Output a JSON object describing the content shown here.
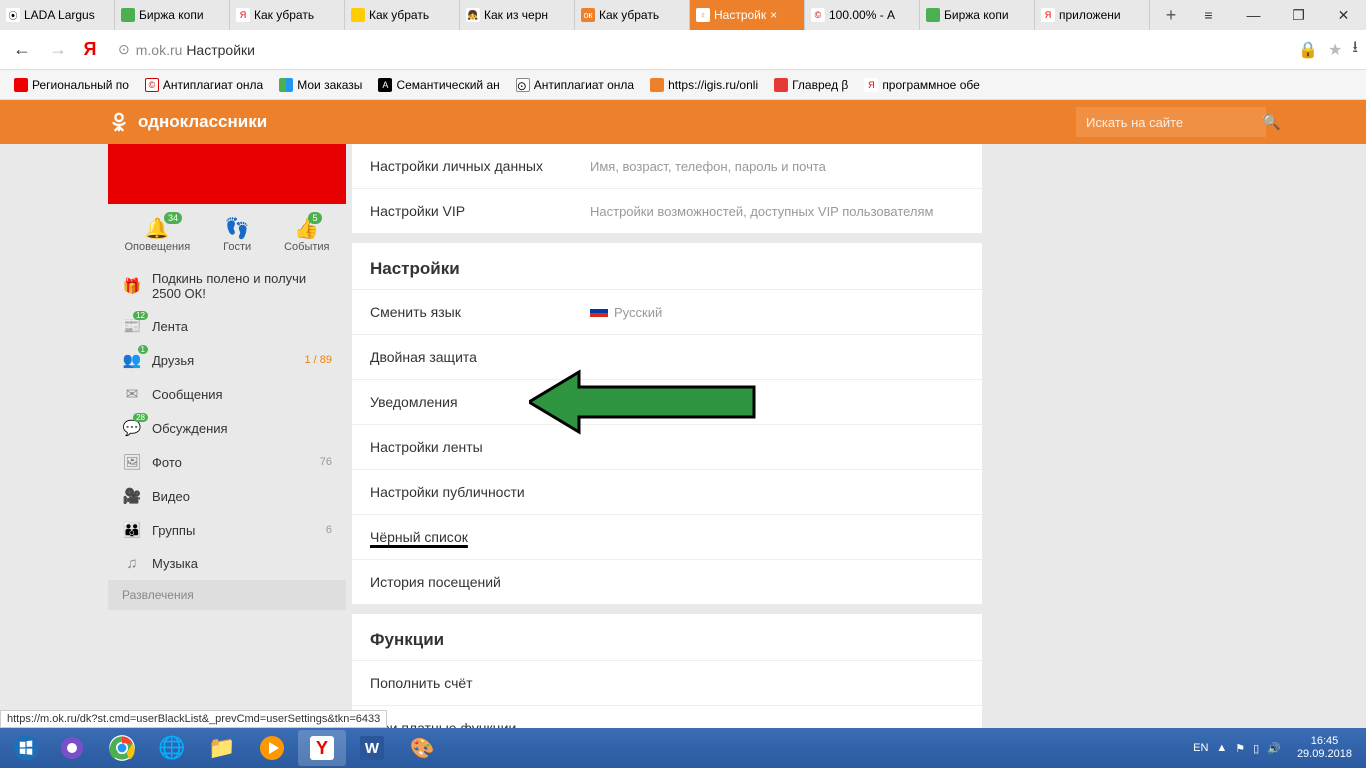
{
  "tabs": [
    {
      "title": "LADA Largus"
    },
    {
      "title": "Биржа копи"
    },
    {
      "title": "Как убрать"
    },
    {
      "title": "Как убрать"
    },
    {
      "title": "Как из черн"
    },
    {
      "title": "Как убрать"
    },
    {
      "title": "Настройк",
      "active": true
    },
    {
      "title": "100.00% - А"
    },
    {
      "title": "Биржа копи"
    },
    {
      "title": "приложени"
    }
  ],
  "url": {
    "host": "m.ok.ru",
    "path": "Настройки"
  },
  "bookmarks": [
    {
      "label": "Региональный по"
    },
    {
      "label": "Антиплагиат онла"
    },
    {
      "label": "Мои заказы"
    },
    {
      "label": "Семантический ан"
    },
    {
      "label": "Антиплагиат онла"
    },
    {
      "label": "https://igis.ru/onli"
    },
    {
      "label": "Главред β"
    },
    {
      "label": "программное обе"
    }
  ],
  "ok": {
    "brand": "одноклассники",
    "search_placeholder": "Искать на сайте"
  },
  "side_actions": {
    "notif": {
      "label": "Оповещения",
      "badge": "34"
    },
    "guests": {
      "label": "Гости"
    },
    "events": {
      "label": "События",
      "badge": "5"
    }
  },
  "promo": {
    "line1": "Подкинь полено и получи",
    "line2": "2500 ОК!"
  },
  "nav": {
    "feed": {
      "label": "Лента",
      "badge": "12"
    },
    "friends": {
      "label": "Друзья",
      "badge": "1",
      "count": "1 / 89"
    },
    "messages": {
      "label": "Сообщения"
    },
    "discuss": {
      "label": "Обсуждения",
      "badge": "28"
    },
    "photo": {
      "label": "Фото",
      "count": "76"
    },
    "video": {
      "label": "Видео"
    },
    "groups": {
      "label": "Группы",
      "count": "6"
    },
    "music": {
      "label": "Музыка"
    }
  },
  "nav_sec": "Развлечения",
  "settings": {
    "personal": {
      "label": "Настройки личных данных",
      "desc": "Имя, возраст, телефон, пароль и почта"
    },
    "vip": {
      "label": "Настройки VIP",
      "desc": "Настройки возможностей, доступных VIP пользователям"
    },
    "head": "Настройки",
    "lang": {
      "label": "Сменить язык",
      "value": "Русский"
    },
    "protect": "Двойная защита",
    "notif": "Уведомления",
    "feed": "Настройки ленты",
    "privacy": "Настройки публичности",
    "blacklist": "Чёрный список",
    "history": "История посещений",
    "func_head": "Функции",
    "topup": "Пополнить счёт",
    "paid": "Мои платные функции"
  },
  "status_url": "https://m.ok.ru/dk?st.cmd=userBlackList&_prevCmd=userSettings&tkn=6433",
  "tray": {
    "lang": "EN",
    "time": "16:45",
    "date": "29.09.2018"
  }
}
